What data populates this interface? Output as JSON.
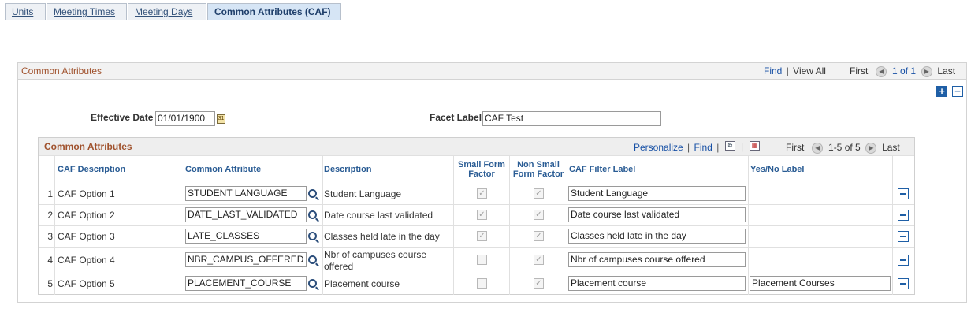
{
  "tabs": [
    {
      "label": "Units",
      "active": false
    },
    {
      "label": "Meeting Times",
      "active": false
    },
    {
      "label": "Meeting Days",
      "active": false
    },
    {
      "label": "Common Attributes (CAF)",
      "active": true
    }
  ],
  "outer": {
    "title": "Common Attributes",
    "find": "Find",
    "separator": "|",
    "view_all": "View All",
    "first": "First",
    "range": "1 of 1",
    "last": "Last"
  },
  "form": {
    "effective_date_label": "Effective Date",
    "effective_date_value": "01/01/1900",
    "facet_label_label": "Facet Label",
    "facet_label_value": "CAF Test"
  },
  "grid": {
    "title": "Common Attributes",
    "personalize": "Personalize",
    "separator": "|",
    "find": "Find",
    "first": "First",
    "range": "1-5 of 5",
    "last": "Last",
    "columns": {
      "caf_description": "CAF Description",
      "common_attribute": "Common Attribute",
      "description": "Description",
      "small_form": "Small Form Factor",
      "non_small_form": "Non Small Form Factor",
      "filter_label": "CAF Filter Label",
      "yes_no_label": "Yes/No Label"
    },
    "rows": [
      {
        "num": "1",
        "caf_description": "CAF Option 1",
        "common_attribute": "STUDENT LANGUAGE",
        "description": "Student Language",
        "small_form": true,
        "non_small_form": true,
        "filter_label": "Student Language",
        "yes_no_label": ""
      },
      {
        "num": "2",
        "caf_description": "CAF Option 2",
        "common_attribute": "DATE_LAST_VALIDATED",
        "description": "Date course last validated",
        "small_form": true,
        "non_small_form": true,
        "filter_label": "Date course last validated",
        "yes_no_label": ""
      },
      {
        "num": "3",
        "caf_description": "CAF Option 3",
        "common_attribute": "LATE_CLASSES",
        "description": "Classes held late in the day",
        "small_form": true,
        "non_small_form": true,
        "filter_label": "Classes held late in the day",
        "yes_no_label": ""
      },
      {
        "num": "4",
        "caf_description": "CAF Option 4",
        "common_attribute": "NBR_CAMPUS_OFFERED",
        "description_line1": "Nbr of campuses course",
        "description_line2": "offered",
        "small_form": false,
        "non_small_form": true,
        "filter_label": "Nbr of campuses course offered",
        "yes_no_label": ""
      },
      {
        "num": "5",
        "caf_description": "CAF Option 5",
        "common_attribute": "PLACEMENT_COURSE",
        "description": "Placement course",
        "small_form": false,
        "non_small_form": true,
        "filter_label": "Placement course",
        "yes_no_label": "Placement Courses"
      }
    ]
  },
  "icons": {
    "prev": "◀",
    "next": "▶",
    "check": "✓",
    "calendar": "31"
  }
}
